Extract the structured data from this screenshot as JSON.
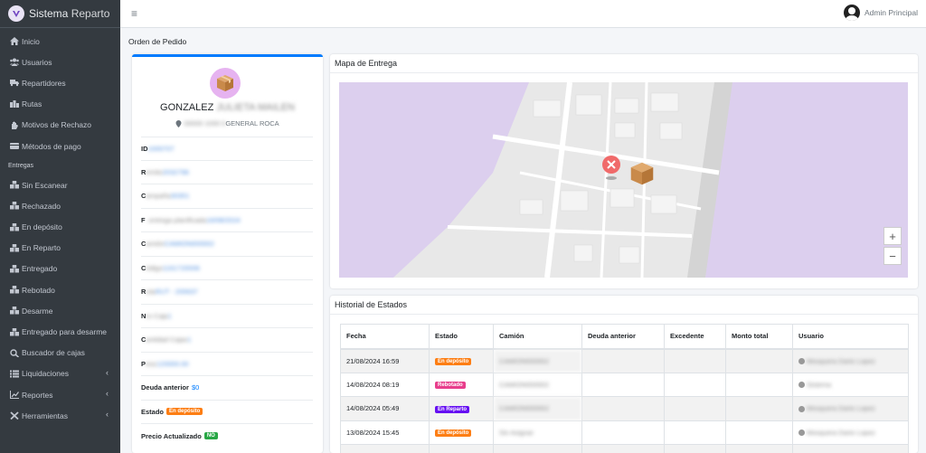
{
  "brand": {
    "name_bold": "Sistema",
    "name_light": "Reparto"
  },
  "sidebar": {
    "items": [
      {
        "label": "Inicio",
        "icon": "home-icon"
      },
      {
        "label": "Usuarios",
        "icon": "users-icon"
      },
      {
        "label": "Repartidores",
        "icon": "truck-icon"
      },
      {
        "label": "Rutas",
        "icon": "route-icon"
      },
      {
        "label": "Motivos de Rechazo",
        "icon": "hand-icon"
      },
      {
        "label": "Métodos de pago",
        "icon": "wallet-icon"
      }
    ],
    "header": "Entregas",
    "items2": [
      {
        "label": "Sin Escanear"
      },
      {
        "label": "Rechazado"
      },
      {
        "label": "En depósito"
      },
      {
        "label": "En Reparto"
      },
      {
        "label": "Entregado"
      },
      {
        "label": "Rebotado"
      },
      {
        "label": "Desarme"
      },
      {
        "label": "Entregado para desarme"
      },
      {
        "label": "Buscador de cajas"
      },
      {
        "label": "Liquidaciones"
      },
      {
        "label": "Reportes"
      },
      {
        "label": "Herramientas"
      }
    ]
  },
  "topbar": {
    "user": "Admin Principal"
  },
  "page": {
    "title": "Orden de Pedido"
  },
  "client": {
    "name": "GONZALEZ",
    "name_blurred": "JULIETA MAILEN",
    "addr_blurred": "00000 1000 0",
    "city": "GENERAL ROCA"
  },
  "info": {
    "id_label": "ID",
    "id_val": "1000707",
    "r1_label": "R",
    "r1_blur": "emito",
    "r1_val": "2032796",
    "r2_label": "C",
    "r2_blur": "ampaña",
    "r2_val": "30351",
    "r3_label": "F",
    "r3_blur": ". entrega planificada",
    "r3_val": "16/08/2024",
    "r4_label": "C",
    "r4_blur": "amión",
    "r4_val": "CAMION000002",
    "r5_label": "C",
    "r5_blur": "ódigo",
    "r5_val": "1161720006",
    "r6_label": "R",
    "r6_blur": "uta",
    "r6_val": "RUT - 200637",
    "r7_label": "N",
    "r7_blur": "ro Caja",
    "r7_val": "1",
    "r8_label": "C",
    "r8_blur": "antidad Cajas",
    "r8_val": "1",
    "r9_label": "P",
    "r9_blur": "eso",
    "r9_val": "120000.00",
    "deuda_label": "Deuda anterior",
    "deuda_val": "$0",
    "estado_label": "Estado",
    "estado_badge": "En depósito",
    "precio_label": "Precio Actualizado",
    "precio_badge": "NO"
  },
  "map": {
    "title": "Mapa de Entrega",
    "zoom_in": "+",
    "zoom_out": "−"
  },
  "history": {
    "title": "Historial de Estados",
    "columns": [
      "Fecha",
      "Estado",
      "Camión",
      "Deuda anterior",
      "Excedente",
      "Monto total",
      "Usuario"
    ],
    "rows": [
      {
        "fecha": "21/08/2024 16:59",
        "estado": "En depósito",
        "camion": "CAMION000002",
        "usuario": "Mosquera Dario Lopez"
      },
      {
        "fecha": "14/08/2024 08:19",
        "estado": "Rebotado",
        "camion": "CAMION000002",
        "usuario": "Sistema"
      },
      {
        "fecha": "14/08/2024 05:49",
        "estado": "En Reparto",
        "camion": "CAMION000002",
        "usuario": "Mosquera Dario Lopez"
      },
      {
        "fecha": "13/08/2024 15:45",
        "estado": "En depósito",
        "camion": "Sin Asignar",
        "usuario": "Mosquera Dario Lopez"
      }
    ]
  }
}
